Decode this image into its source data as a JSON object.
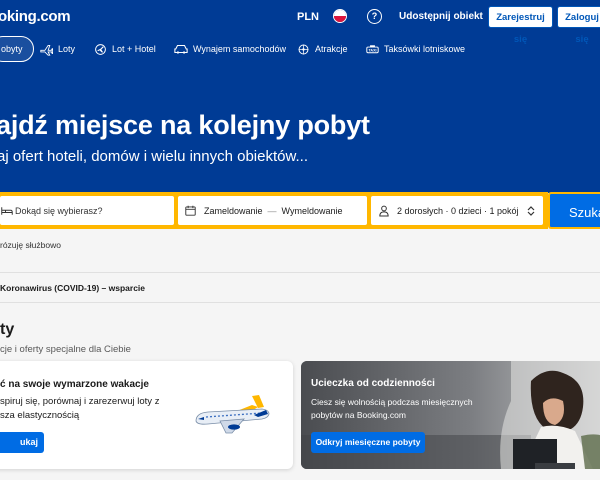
{
  "header": {
    "logo": "oking.com",
    "currency": "PLN",
    "help_icon": "?",
    "list_property": "Udostępnij obiekt",
    "register": "Zarejestruj się",
    "login": "Zaloguj się"
  },
  "nav": [
    {
      "label": "obyty",
      "icon": "bed-icon"
    },
    {
      "label": "Loty",
      "icon": "plane-icon"
    },
    {
      "label": "Lot + Hotel",
      "icon": "flight-hotel-icon"
    },
    {
      "label": "Wynajem samochodów",
      "icon": "car-icon"
    },
    {
      "label": "Atrakcje",
      "icon": "attractions-icon"
    },
    {
      "label": "Taksówki lotniskowe",
      "icon": "taxi-icon"
    }
  ],
  "hero": {
    "title": "ajdź miejsce na kolejny pobyt",
    "subtitle": "aj ofert hoteli, domów i wielu innych obiektów..."
  },
  "search": {
    "destination_placeholder": "Dokąd się wybierasz?",
    "checkin": "Zameldowanie",
    "dash": "—",
    "checkout": "Wymeldowanie",
    "guests": "2 dorosłych · 0 dzieci · 1 pokój",
    "button": "Szukaj"
  },
  "business_travel": "rózuję służbowo",
  "covid": "Koronawirus (COVID-19) – wsparcie",
  "offers": {
    "heading": "ty",
    "subheading": "cje i oferty specjalne dla Ciebie",
    "card1": {
      "title": "ć na swoje wymarzone wakacje",
      "desc": "spiruj się, porównaj i zarezerwuj loty z\nsza elastycznością",
      "button": "ukaj lotów"
    },
    "card2": {
      "title": "Ucieczka od codzienności",
      "desc": "Ciesz się wolnością podczas miesięcznych pobytów na Booking.com",
      "button": "Odkryj miesięczne pobyty"
    }
  },
  "colors": {
    "brand_blue": "#003b95",
    "action_blue": "#006ce4",
    "search_yellow": "#ffb700"
  }
}
